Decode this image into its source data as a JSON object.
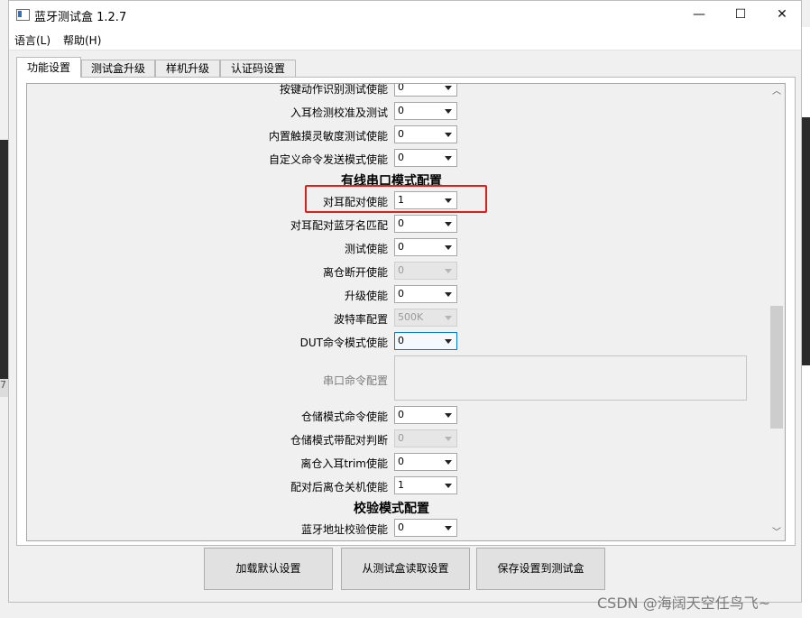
{
  "window": {
    "title": "蓝牙测试盒 1.2.7",
    "controls": {
      "minimize": "—",
      "maximize": "☐",
      "close": "✕"
    }
  },
  "menu": [
    {
      "label": "语言(L)"
    },
    {
      "label": "帮助(H)"
    }
  ],
  "tabs": [
    {
      "label": "功能设置",
      "active": true
    },
    {
      "label": "测试盒升级"
    },
    {
      "label": "样机升级"
    },
    {
      "label": "认证码设置"
    }
  ],
  "settings": {
    "rows_top": [
      {
        "label": "按键动作识别测试使能",
        "value": "0"
      },
      {
        "label": "入耳检测校准及测试",
        "value": "0"
      },
      {
        "label": "内置触摸灵敏度测试使能",
        "value": "0"
      },
      {
        "label": "自定义命令发送模式使能",
        "value": "0"
      }
    ],
    "section_wired": "有线串口模式配置",
    "rows_wired": [
      {
        "label": "对耳配对使能",
        "value": "1"
      },
      {
        "label": "对耳配对蓝牙名匹配",
        "value": "0"
      },
      {
        "label": "测试使能",
        "value": "0"
      },
      {
        "label": "离仓断开使能",
        "value": "0",
        "disabled": true
      },
      {
        "label": "升级使能",
        "value": "0"
      },
      {
        "label": "波特率配置",
        "value": "500K",
        "disabled": true
      },
      {
        "label": "DUT命令模式使能",
        "value": "0"
      }
    ],
    "serial_command_label": "串口命令配置",
    "rows_storage": [
      {
        "label": "仓储模式命令使能",
        "value": "0"
      },
      {
        "label": "仓储模式带配对判断",
        "value": "0",
        "disabled": true
      },
      {
        "label": "离仓入耳trim使能",
        "value": "0"
      },
      {
        "label": "配对后离仓关机使能",
        "value": "1"
      }
    ],
    "section_verify": "校验模式配置",
    "rows_verify": [
      {
        "label": "蓝牙地址校验使能",
        "value": "0"
      }
    ]
  },
  "buttons": {
    "load_default": "加载默认设置",
    "read_from_box": "从测试盒读取设置",
    "save_to_box": "保存设置到测试盒"
  },
  "watermark": "CSDN @海阔天空任鸟飞~",
  "edge_text": "7"
}
